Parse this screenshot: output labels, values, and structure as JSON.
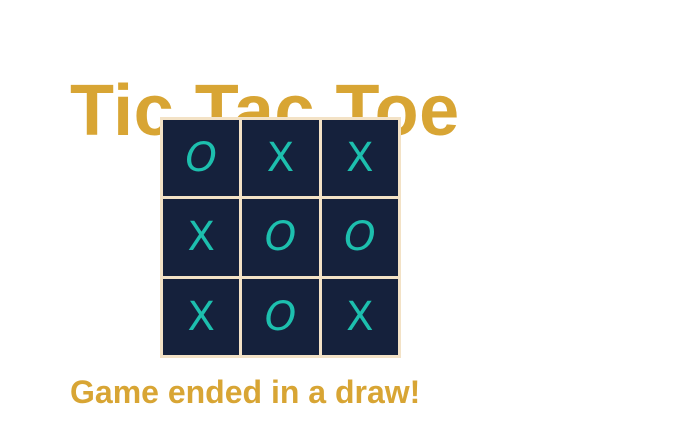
{
  "title": "Tic Tac Toe",
  "board": {
    "cells": [
      "O",
      "X",
      "X",
      "X",
      "O",
      "O",
      "X",
      "O",
      "X"
    ]
  },
  "status": "Game ended in a draw!",
  "colors": {
    "accent": "#d8a534",
    "cell_background": "#15213c",
    "mark": "#1dbfae",
    "grid_lines": "#f3e2c6",
    "page_background": "#ffffff"
  }
}
